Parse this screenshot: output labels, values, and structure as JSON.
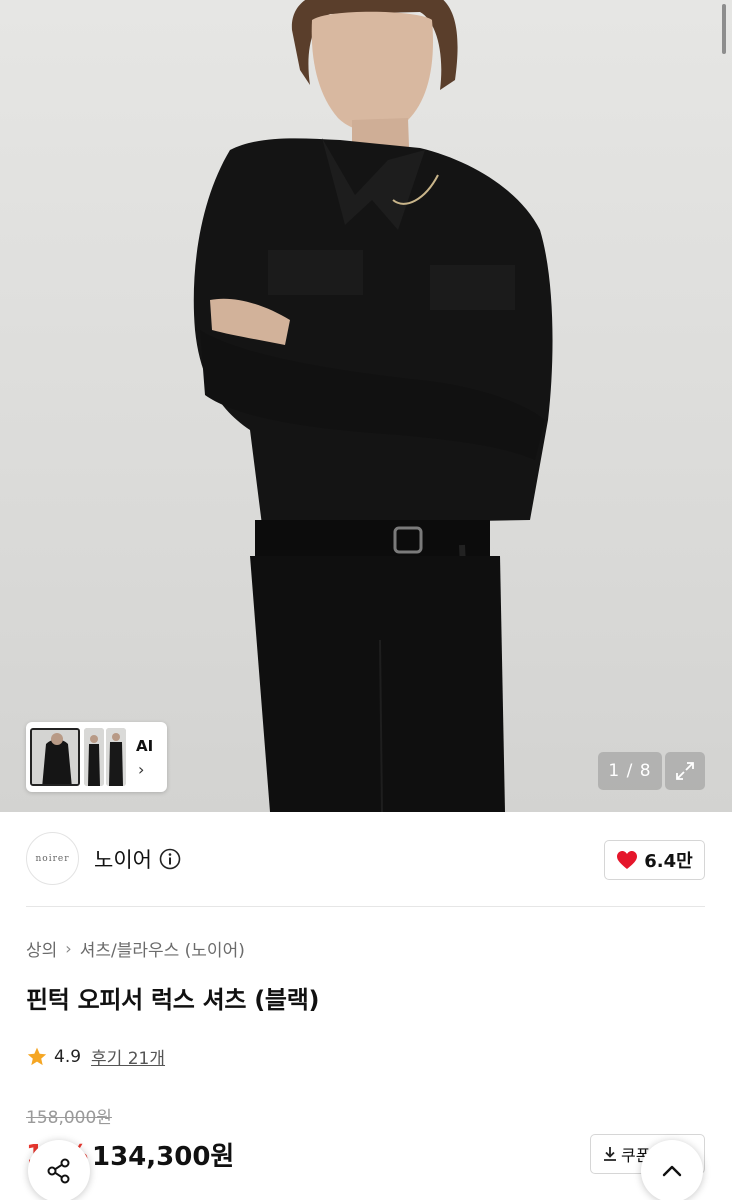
{
  "gallery": {
    "counter": "1 / 8",
    "ai_label": "AI",
    "thumbnail_count": 3
  },
  "brand": {
    "logo_text": "noirer",
    "name": "노이어",
    "likes": "6.4만"
  },
  "breadcrumb": [
    "상의",
    "셔츠/블라우스 (노이어)"
  ],
  "product": {
    "title": "핀턱 오피서 럭스 셔츠 (블랙)",
    "rating": "4.9",
    "reviews": "후기 21개",
    "original_price": "158,000원",
    "discount": "15%",
    "sale_price": "134,300원",
    "coupon_label": "쿠폰"
  },
  "icons": {
    "heart": "heart-icon",
    "star": "star-icon",
    "info": "info-icon",
    "expand": "expand-icon",
    "share": "share-icon",
    "scroll_top": "chevron-up-icon",
    "download": "download-icon"
  },
  "colors": {
    "heart": "#e5162b",
    "star": "#f5a623",
    "discount": "#e8372f"
  }
}
